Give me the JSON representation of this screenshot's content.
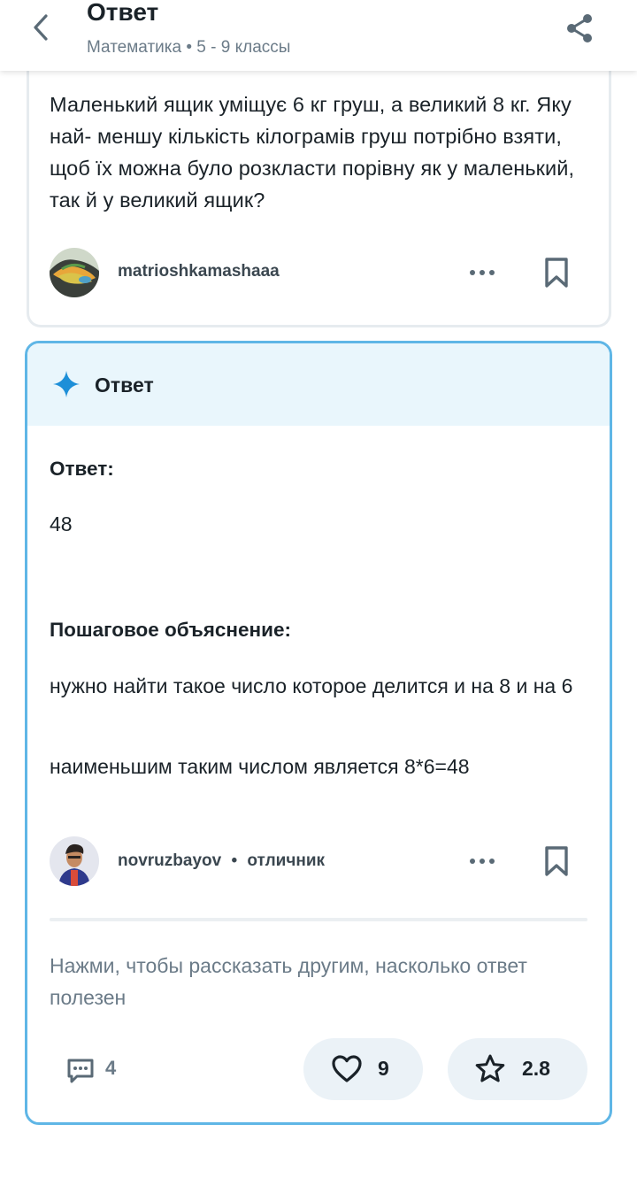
{
  "header": {
    "title": "Ответ",
    "subject": "Математика",
    "separator": "•",
    "grade": "5 - 9 классы"
  },
  "question": {
    "text": "Маленький ящик уміщує 6 кг груш, а великий 8 кг. Яку най- меншу кількість кілограмів груш потрібно взяти, щоб їх можна було розкласти порівну як у маленький, так й у великий ящик?",
    "author": "matrioshkamashaaa"
  },
  "answer": {
    "header_title": "Ответ",
    "answer_label": "Ответ:",
    "answer_value": "48",
    "explanation_label": "Пошаговое объяснение:",
    "explanation_line1": "нужно найти такое число которое делится и на 8 и на 6",
    "explanation_line2": "наименьшим таким числом является 8*6=48",
    "author": "novruzbayov",
    "author_separator": "•",
    "author_rank": "отличник",
    "rate_prompt": "Нажми, чтобы рассказать другим, насколько ответ полезен",
    "comments_count": "4",
    "likes_count": "9",
    "rating": "2.8"
  },
  "icons": {
    "back": "chevron-left-icon",
    "share": "share-icon",
    "more": "more-dots-icon",
    "bookmark": "bookmark-icon",
    "sparkle": "sparkle-icon",
    "comments": "comment-icon",
    "like": "heart-icon",
    "rate": "star-icon"
  },
  "colors": {
    "accent": "#5fb6e6",
    "sparkle": "#1d8fd8",
    "answer_header_bg": "#e9f6fc",
    "pill_bg": "#ebf2f7",
    "muted_text": "#6b7b88"
  }
}
